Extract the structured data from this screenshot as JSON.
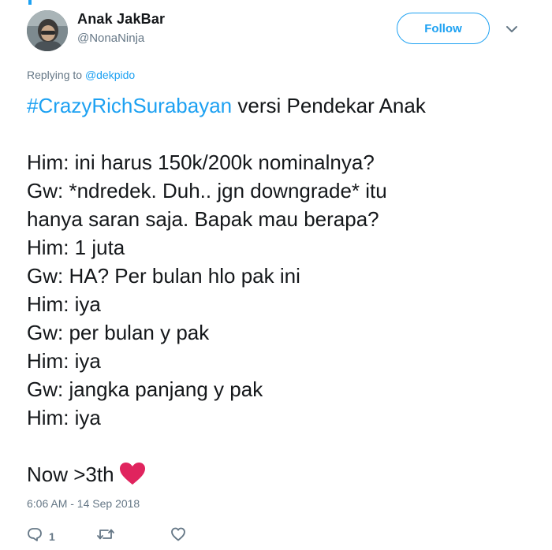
{
  "author": {
    "display_name": "Anak JakBar",
    "handle": "@NonaNinja"
  },
  "follow_button": {
    "label": "Follow"
  },
  "reply_context": {
    "prefix": "Replying to ",
    "mention": "@dekpido"
  },
  "tweet": {
    "hashtag": "#CrazyRichSurabayan",
    "headline_rest": " versi Pendekar Anak",
    "lines": [
      "Him: ini harus 150k/200k nominalnya?",
      "Gw: *ndredek. Duh.. jgn downgrade* itu",
      "hanya saran saja. Bapak mau berapa?",
      "Him: 1 juta",
      "Gw: HA? Per bulan hlo pak ini",
      "Him: iya",
      "Gw: per bulan y pak",
      "Him: iya",
      "Gw: jangka panjang y pak",
      "Him: iya"
    ],
    "closing": "Now >3th",
    "closing_emoji": "red-heart-icon"
  },
  "timestamp": "6:06 AM - 14 Sep 2018",
  "actions": {
    "reply_count": "1",
    "retweet_count": "",
    "like_count": ""
  },
  "colors": {
    "accent": "#1da1f2",
    "secondary_text": "#657786",
    "heart": "#e0245e"
  }
}
